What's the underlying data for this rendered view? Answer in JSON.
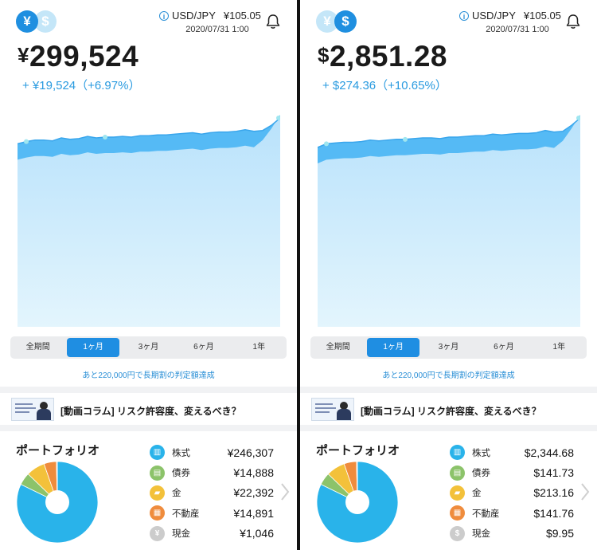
{
  "colors": {
    "accent": "#1f8fe0",
    "gain": "#2a9be0",
    "stocks": "#29b3ea",
    "bonds": "#8cc36a",
    "gold": "#f3c13a",
    "realestate": "#ef8c3d",
    "cash": "#cccccc"
  },
  "panels": [
    {
      "currency_icons": {
        "active": "¥",
        "inactive": "$"
      },
      "fx": {
        "label": "USD/JPY",
        "rate": "¥105.05",
        "date": "2020/07/31 1:00"
      },
      "total": {
        "symbol": "¥",
        "amount": "299,524"
      },
      "gain": "+ ¥19,524（+6.97%）",
      "periods": [
        {
          "label": "全期間"
        },
        {
          "label": "1ヶ月"
        },
        {
          "label": "3ヶ月"
        },
        {
          "label": "6ヶ月"
        },
        {
          "label": "1年"
        }
      ],
      "selected_period": 1,
      "promo": "あと220,000円で長期割の判定額達成",
      "banner": "[動画コラム] リスク許容度、変えるべき？",
      "portfolio_title": "ポートフォリオ",
      "holdings": [
        {
          "icon": "bank-icon",
          "label": "株式",
          "value": "¥246,307",
          "share": 0.8223
        },
        {
          "icon": "bond-certificate-icon",
          "label": "債券",
          "value": "¥14,888",
          "share": 0.0497
        },
        {
          "icon": "gold-bars-icon",
          "label": "金",
          "value": "¥22,392",
          "share": 0.0748
        },
        {
          "icon": "building-icon",
          "label": "不動産",
          "value": "¥14,891",
          "share": 0.0497
        },
        {
          "icon": "yen-coin-icon",
          "label": "現金",
          "value": "¥1,046",
          "share": 0.0035
        }
      ],
      "chart_data": {
        "type": "area",
        "trend": [
          0.55,
          0.58,
          0.6,
          0.6,
          0.59,
          0.63,
          0.61,
          0.62,
          0.65,
          0.63,
          0.64,
          0.64,
          0.65,
          0.64,
          0.66,
          0.66,
          0.67,
          0.67,
          0.68,
          0.69,
          0.7,
          0.68,
          0.7,
          0.71,
          0.71,
          0.72,
          0.74,
          0.72,
          0.73,
          0.8,
          0.9
        ]
      }
    },
    {
      "currency_icons": {
        "active": "$",
        "inactive": "¥"
      },
      "fx": {
        "label": "USD/JPY",
        "rate": "¥105.05",
        "date": "2020/07/31 1:00"
      },
      "total": {
        "symbol": "$",
        "amount": "2,851.28"
      },
      "gain": "+ $274.36（+10.65%）",
      "periods": [
        {
          "label": "全期間"
        },
        {
          "label": "1ヶ月"
        },
        {
          "label": "3ヶ月"
        },
        {
          "label": "6ヶ月"
        },
        {
          "label": "1年"
        }
      ],
      "selected_period": 1,
      "promo": "あと220,000円で長期割の判定額達成",
      "banner": "[動画コラム] リスク許容度、変えるべき？",
      "portfolio_title": "ポートフォリオ",
      "holdings": [
        {
          "icon": "bank-icon",
          "label": "株式",
          "value": "$2,344.68",
          "share": 0.8223
        },
        {
          "icon": "bond-certificate-icon",
          "label": "債券",
          "value": "$141.73",
          "share": 0.0497
        },
        {
          "icon": "gold-bars-icon",
          "label": "金",
          "value": "$213.16",
          "share": 0.0748
        },
        {
          "icon": "building-icon",
          "label": "不動産",
          "value": "$141.76",
          "share": 0.0497
        },
        {
          "icon": "dollar-coin-icon",
          "label": "現金",
          "value": "$9.95",
          "share": 0.0035
        }
      ],
      "chart_data": {
        "type": "area",
        "trend": [
          0.5,
          0.55,
          0.56,
          0.57,
          0.57,
          0.58,
          0.6,
          0.59,
          0.6,
          0.61,
          0.61,
          0.62,
          0.63,
          0.63,
          0.62,
          0.64,
          0.64,
          0.65,
          0.66,
          0.66,
          0.68,
          0.67,
          0.68,
          0.69,
          0.69,
          0.7,
          0.73,
          0.71,
          0.72,
          0.8,
          0.9
        ]
      }
    }
  ]
}
